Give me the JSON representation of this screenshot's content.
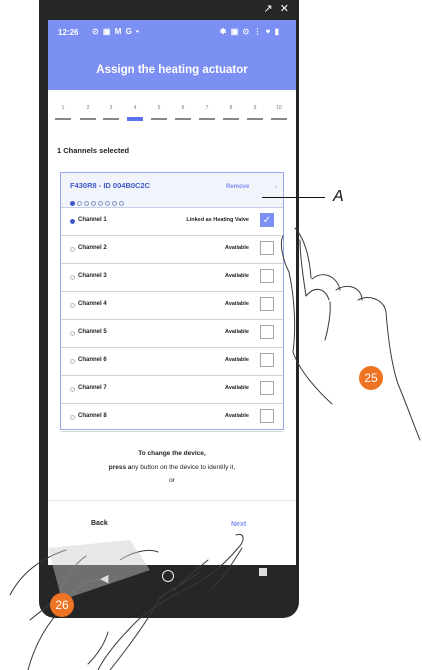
{
  "status_bar": {
    "time": "12:26",
    "left_icons": "⊙ ▣ M G •",
    "right_icons": "✱ ▣ ⊙ ⋮ ♥ ▮"
  },
  "window_controls": "↗ ✕",
  "header": {
    "title": "Assign the heating actuator"
  },
  "steps": {
    "labels": [
      "1",
      "2",
      "3",
      "4",
      "5",
      "6",
      "7",
      "8",
      "9",
      "10"
    ],
    "current": 4
  },
  "selection": {
    "count_text": "1 Channels selected"
  },
  "device": {
    "name": "F430R8 - ID 004B0C2C",
    "remove_label": "Remove",
    "page_dots": 8,
    "active_dot": 1
  },
  "channels": [
    {
      "name": "Channel 1",
      "status": "Linked as Heating Valve",
      "checked": true
    },
    {
      "name": "Channel 2",
      "status": "Available",
      "checked": false
    },
    {
      "name": "Channel 3",
      "status": "Available",
      "checked": false
    },
    {
      "name": "Channel 4",
      "status": "Available",
      "checked": false
    },
    {
      "name": "Channel 5",
      "status": "Available",
      "checked": false
    },
    {
      "name": "Channel 6",
      "status": "Available",
      "checked": false
    },
    {
      "name": "Channel 7",
      "status": "Available",
      "checked": false
    },
    {
      "name": "Channel 8",
      "status": "Available",
      "checked": false
    }
  ],
  "instructions": {
    "line1": "To change the device,",
    "line2_bold": "press a",
    "line2_rest": "ny button on the device to identify it,",
    "line3": "or"
  },
  "footer": {
    "back_label": "Back",
    "next_label": "Next"
  },
  "annotations": {
    "callout_label": "A",
    "step_25": "25",
    "step_26": "26"
  },
  "colors": {
    "accent": "#7c8ff3",
    "accent_dark": "#3f59c8",
    "badge": "#ee7322"
  }
}
